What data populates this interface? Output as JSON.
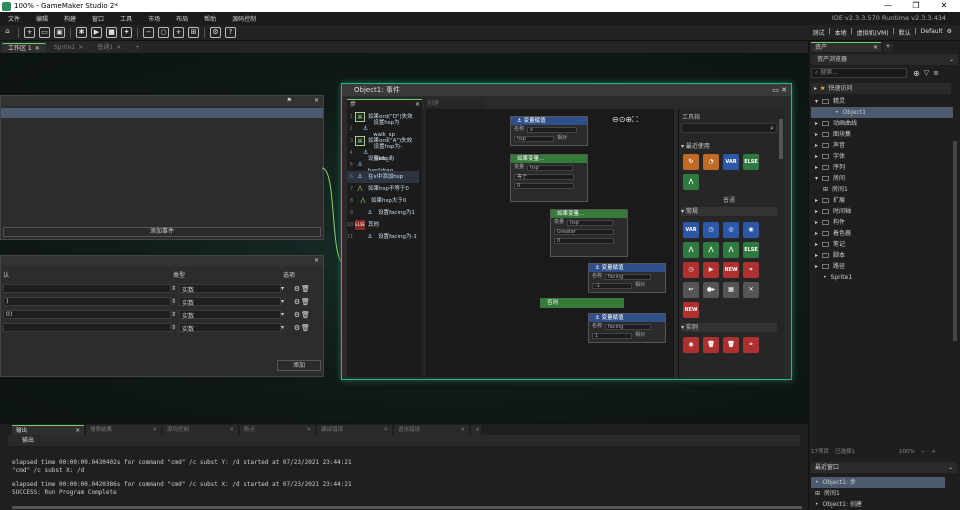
{
  "titlebar": {
    "title": "100% - GameMaker Studio 2*",
    "minimize": "—",
    "maximize": "❐",
    "close": "✕"
  },
  "menu": {
    "items": [
      "文件",
      "编辑",
      "构建",
      "窗口",
      "工具",
      "市场",
      "布局",
      "帮助",
      "源码控制"
    ],
    "version": "IDE v2.3.3.570  Runtime v2.3.3.434"
  },
  "toolbar": {
    "right": {
      "test": "测试",
      "local": "本地",
      "vm": "虚拟机(VM)",
      "default_label": "默认",
      "default_value": "Default"
    }
  },
  "workspace_tabs": [
    {
      "label": "工作区 1",
      "active": true
    },
    {
      "label": "Sprite1",
      "active": false
    },
    {
      "label": "普通1",
      "active": false
    }
  ],
  "left_panel": {
    "add_event": "添加事件"
  },
  "vars_panel": {
    "col_default": "默认",
    "col_type": "类型",
    "col_options": "选项",
    "rows": [
      {
        "type": "实数"
      },
      {
        "type": "实数"
      },
      {
        "type": "实数"
      },
      {
        "type": "实数"
      }
    ],
    "add": "添加",
    "row_labels": [
      "认",
      ")",
      "0)"
    ]
  },
  "object_window": {
    "title": "Object1: 事件",
    "left_tab": "步",
    "right_tab": "创建",
    "events": [
      {
        "num": "1",
        "text": "如果ord(\"D\")失效"
      },
      {
        "num": "2",
        "text": "设置hsp为walk_sp"
      },
      {
        "num": "3",
        "text": "如果ord(\"A\")失效"
      },
      {
        "num": "4",
        "text": "设置hsp为-walk_s"
      },
      {
        "num": "5",
        "text": "设置hsp为hsp*drag"
      },
      {
        "num": "6",
        "text": "在x中添加hsp"
      },
      {
        "num": "7",
        "text": "如果hsp不等于0"
      },
      {
        "num": "8",
        "text": "如果hsp大于0"
      },
      {
        "num": "9",
        "text": "设置facing为1"
      },
      {
        "num": "10",
        "text": "其他"
      },
      {
        "num": "11",
        "text": "设置facing为-1"
      }
    ],
    "nodes": {
      "n1": {
        "title": "⚓ 变量赋值",
        "label": "名称",
        "val": "x",
        "v2": "hsp",
        "rel": "相对"
      },
      "n2": {
        "title": "如果变量...",
        "label": "变量",
        "val": "hsp",
        "op": "等于",
        "v": "0"
      },
      "n3": {
        "title": "如果变量...",
        "label": "变量",
        "val": "hsp",
        "op": "Greater",
        "v": "0"
      },
      "n4": {
        "title": "⚓ 变量赋值",
        "label": "名称",
        "val": "facing",
        "v2": "-1",
        "rel": "相对"
      },
      "n5": {
        "title": "否则",
        "label": ""
      },
      "n6": {
        "title": "⚓ 变量赋值",
        "label": "名称",
        "val": "facing",
        "v2": "1",
        "rel": "相对"
      }
    },
    "toolbox": {
      "title": "工具箱",
      "recent": "最近使用",
      "common": "常规",
      "common_hdr": "普通",
      "instances": "实例"
    },
    "toolbox_acts": {
      "var": "VAR",
      "else": "ELSE",
      "new": "NEW"
    }
  },
  "bottom": {
    "tabs": [
      {
        "label": "输出",
        "active": true
      },
      {
        "label": "搜索结果"
      },
      {
        "label": "源码控制"
      },
      {
        "label": "断点"
      },
      {
        "label": "编译错误"
      },
      {
        "label": "语法错误"
      }
    ],
    "header": "输出",
    "lines": [
      "elapsed time 00:00:00.0430402s for command \"cmd\" /c subst Y: /d started at 07/23/2021 23:44:21",
      "\"cmd\" /c subst X: /d",
      "elapsed time 00:00:00.0420386s for command \"cmd\" /c subst X: /d started at 07/23/2021 23:44:21",
      "SUCCESS: Run Program Complete"
    ]
  },
  "asset": {
    "tab": "资产",
    "title": "资产浏览器",
    "search": "搜索...",
    "quick": "快速访问",
    "tree": [
      {
        "label": "精灵",
        "indent": 0
      },
      {
        "label": "Object1",
        "indent": 2,
        "selected": true
      },
      {
        "label": "动画曲线",
        "indent": 1
      },
      {
        "label": "图块集",
        "indent": 1
      },
      {
        "label": "声音",
        "indent": 1
      },
      {
        "label": "字体",
        "indent": 1
      },
      {
        "label": "序列",
        "indent": 1
      },
      {
        "label": "房间",
        "indent": 0
      },
      {
        "label": "房间1",
        "indent": 2
      },
      {
        "label": "扩展",
        "indent": 1
      },
      {
        "label": "时间轴",
        "indent": 1
      },
      {
        "label": "构件",
        "indent": 1
      },
      {
        "label": "着色器",
        "indent": 1
      },
      {
        "label": "笔记",
        "indent": 1
      },
      {
        "label": "脚本",
        "indent": 1
      },
      {
        "label": "路径",
        "indent": 1
      },
      {
        "label": "Sprite1",
        "indent": 2
      }
    ],
    "footer": {
      "count": "17项目",
      "selected": "已选择1",
      "zoom": "100%"
    },
    "recent": {
      "title": "最近窗口",
      "items": [
        "Object1: 步",
        "房间1",
        "Object1: 创建"
      ]
    }
  }
}
